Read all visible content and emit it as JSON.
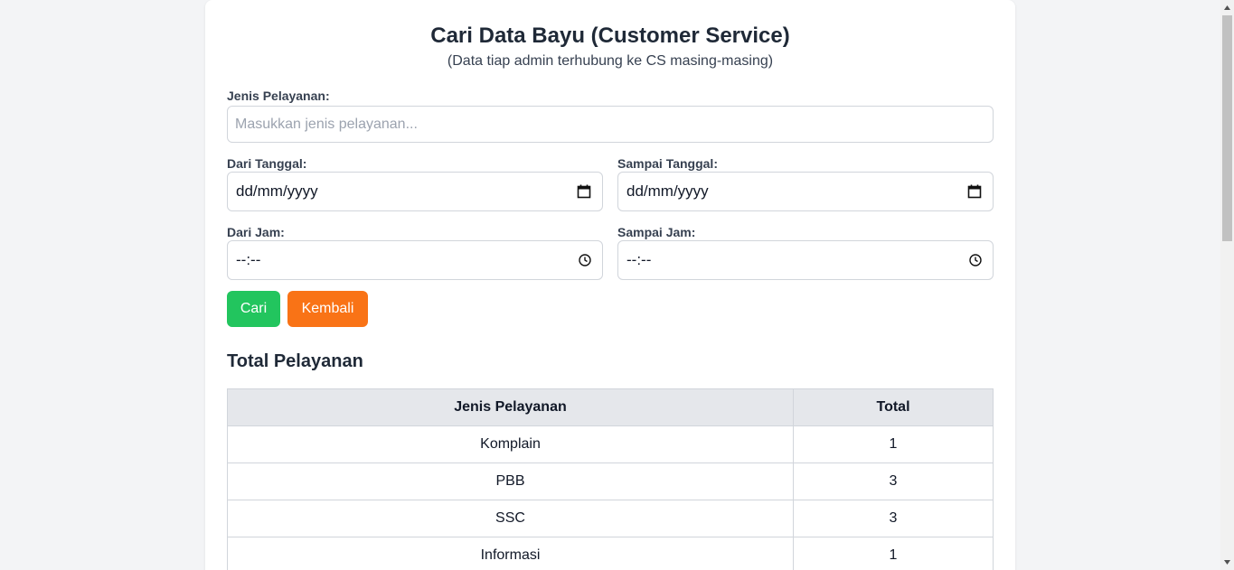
{
  "header": {
    "title": "Cari Data Bayu (Customer Service)",
    "subtitle": "(Data tiap admin terhubung ke CS masing-masing)"
  },
  "form": {
    "jenis_label": "Jenis Pelayanan:",
    "jenis_placeholder": "Masukkan jenis pelayanan...",
    "dari_tanggal_label": "Dari Tanggal:",
    "dari_tanggal_value": "dd/mm/yyyy",
    "sampai_tanggal_label": "Sampai Tanggal:",
    "sampai_tanggal_value": "dd/mm/yyyy",
    "dari_jam_label": "Dari Jam:",
    "dari_jam_value": "--:--",
    "sampai_jam_label": "Sampai Jam:",
    "sampai_jam_value": "--:--",
    "cari_label": "Cari",
    "kembali_label": "Kembali"
  },
  "summary": {
    "title": "Total Pelayanan",
    "headers": [
      "Jenis Pelayanan",
      "Total"
    ],
    "rows": [
      {
        "jenis": "Komplain",
        "total": "1"
      },
      {
        "jenis": "PBB",
        "total": "3"
      },
      {
        "jenis": "SSC",
        "total": "3"
      },
      {
        "jenis": "Informasi",
        "total": "1"
      }
    ]
  },
  "icons": {
    "date": "calendar-icon",
    "time": "clock-icon"
  },
  "colors": {
    "cari_button": "#22c55e",
    "kembali_button": "#f97316",
    "table_header_bg": "#e5e7eb",
    "page_bg": "#f3f4f6"
  }
}
